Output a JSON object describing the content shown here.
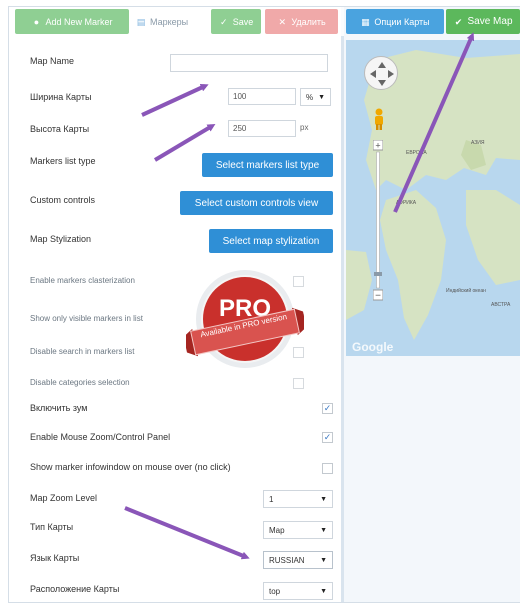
{
  "toolbar": {
    "add_marker_label": "Add New Marker",
    "markers_tab_label": "Маркеры",
    "save_label": "Save",
    "delete_label": "Удалить",
    "map_options_label": "Опции Карты",
    "save_map_label": "Save Map"
  },
  "form": {
    "map_name": {
      "label": "Map Name",
      "value": ""
    },
    "map_width": {
      "label": "Ширина Карты",
      "value": "100",
      "unit": "%"
    },
    "map_height": {
      "label": "Высота Карты",
      "value": "250",
      "unit": "px"
    },
    "markers_list_type": {
      "label": "Markers list type",
      "button": "Select markers list type"
    },
    "custom_controls": {
      "label": "Custom controls",
      "button": "Select custom controls view"
    },
    "map_stylization": {
      "label": "Map Stylization",
      "button": "Select map stylization"
    },
    "pro_options": [
      {
        "label": "Enable markers clasterization",
        "checked": false
      },
      {
        "label": "Show only visible markers in list",
        "checked": false
      },
      {
        "label": "Disable search in markers list",
        "checked": false
      },
      {
        "label": "Disable categories selection",
        "checked": false
      }
    ],
    "options": [
      {
        "label": "Включить зум",
        "checked": true
      },
      {
        "label": "Enable Mouse Zoom/Control Panel",
        "checked": true
      },
      {
        "label": "Show marker infowindow on mouse over (no click)",
        "checked": false
      }
    ],
    "zoom_level": {
      "label": "Map Zoom Level",
      "value": "1"
    },
    "map_type": {
      "label": "Тип Карты",
      "value": "Map"
    },
    "map_language": {
      "label": "Язык Карты",
      "value": "RUSSIAN"
    },
    "map_position": {
      "label": "Расположение Карты",
      "value": "top"
    }
  },
  "pro_badge": {
    "title": "PRO",
    "ribbon": "Available in PRO version"
  },
  "map": {
    "provider_logo": "Google",
    "labels": {
      "europe": "ЕВРОПА",
      "africa": "АФРИКА",
      "indian_ocean": "Индийский океан",
      "asia": "АЗИЯ",
      "australia": "АВСТРА"
    }
  },
  "colors": {
    "accent_blue": "#2f8fd6",
    "save_green": "#5cb85c",
    "delete_red": "#f0a9a9",
    "arrow_purple": "#8a56b8",
    "pro_red": "#c9302c"
  }
}
